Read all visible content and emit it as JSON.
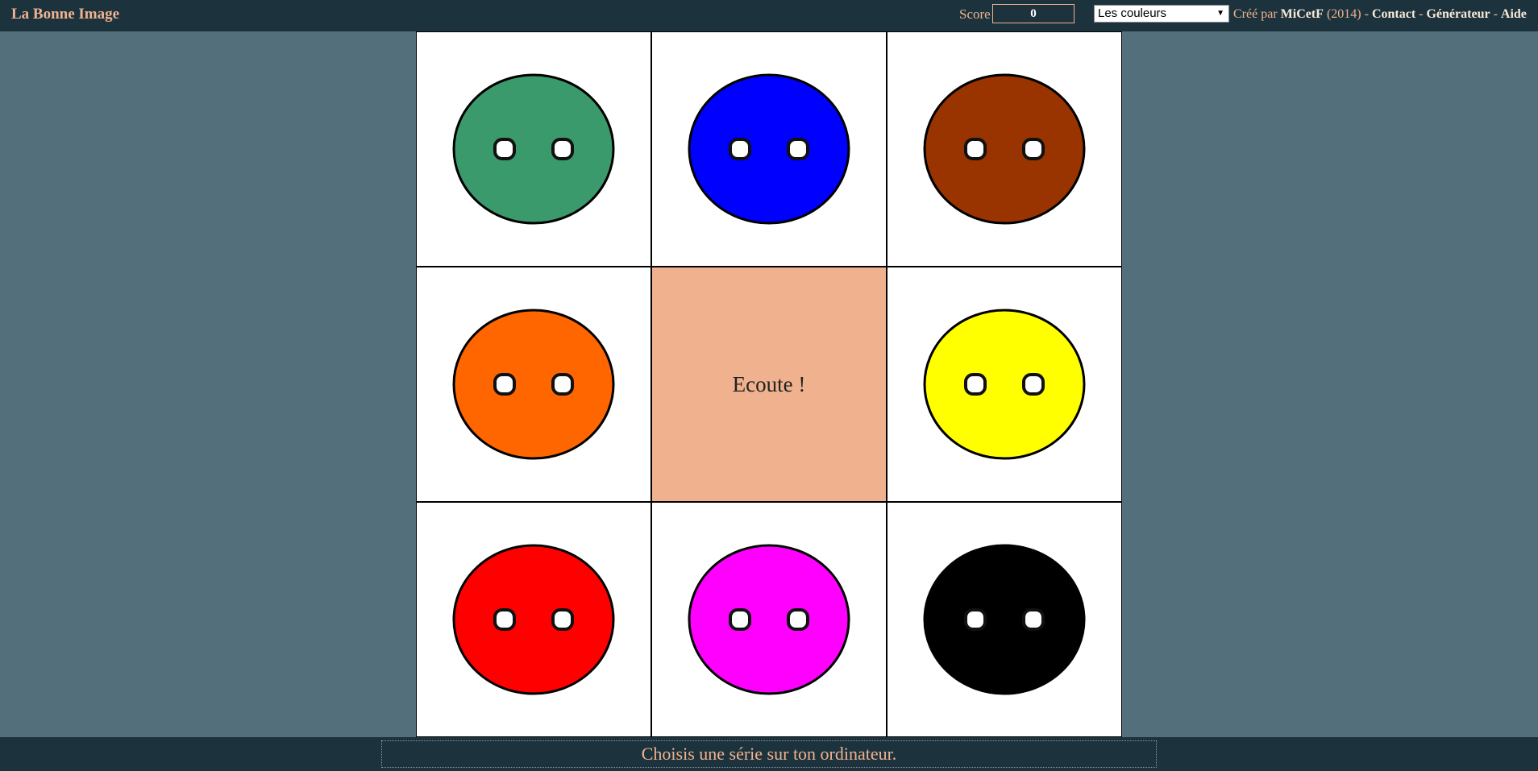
{
  "header": {
    "title": "La Bonne Image",
    "score_label": "Score",
    "score_value": "0",
    "series_selected": "Les couleurs",
    "credits_prefix": "Créé par",
    "author": "MiCetF",
    "year": "(2014) -",
    "sep1": "-",
    "sep2": "-",
    "links": {
      "contact": "Contact",
      "generator": "Générateur",
      "help": "Aide"
    }
  },
  "board": {
    "listen_label": "Ecoute !",
    "buttons": [
      {
        "color": "#3a9a6c",
        "icon": "green-button-icon"
      },
      {
        "color": "#0000ff",
        "icon": "blue-button-icon"
      },
      {
        "color": "#993300",
        "icon": "brown-button-icon"
      },
      {
        "color": "#ff6600",
        "icon": "orange-button-icon"
      },
      {
        "color": "#ffff00",
        "icon": "yellow-button-icon"
      },
      {
        "color": "#ff0000",
        "icon": "red-button-icon"
      },
      {
        "color": "#ff00ff",
        "icon": "magenta-button-icon"
      },
      {
        "color": "#000000",
        "icon": "black-button-icon"
      }
    ]
  },
  "footer": {
    "message": "Choisis une série sur ton ordinateur."
  },
  "colors": {
    "bar": "#1c333e",
    "background": "#536f7b",
    "accent": "#f0b28e"
  }
}
